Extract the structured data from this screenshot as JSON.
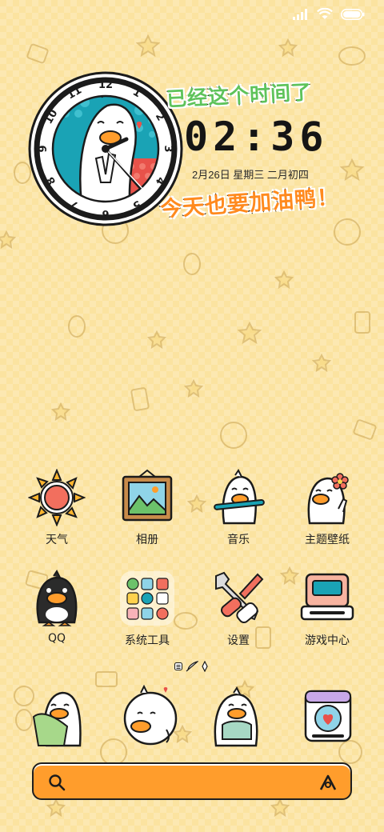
{
  "colors": {
    "background": "#fbe3a0",
    "accent_orange": "#ff9d2c",
    "slogan_green": "#5ec35a",
    "slogan_orange": "#ff8a1e",
    "clock_teal": "#1aa3b5",
    "clock_red": "#e8524a"
  },
  "status_bar": {
    "icons": [
      "signal-icon",
      "wifi-icon",
      "battery-icon"
    ]
  },
  "widget": {
    "slogan_top": "已经这个时间了",
    "time": "02:36",
    "date": "2月26日 星期三 二月初四",
    "slogan_bottom": "今天也要加油鸭！",
    "clock_numbers": [
      "12",
      "1",
      "2",
      "3",
      "4",
      "5",
      "6",
      "7",
      "8",
      "9",
      "10",
      "11"
    ]
  },
  "apps_row1": [
    {
      "label": "天气",
      "icon": "sun-icon"
    },
    {
      "label": "相册",
      "icon": "picture-frame-icon"
    },
    {
      "label": "音乐",
      "icon": "duck-flute-icon"
    },
    {
      "label": "主题壁纸",
      "icon": "duck-flower-icon"
    }
  ],
  "apps_row2": [
    {
      "label": "QQ",
      "icon": "black-duck-icon"
    },
    {
      "label": "系统工具",
      "icon": "folder-icon"
    },
    {
      "label": "设置",
      "icon": "tools-icon"
    },
    {
      "label": "游戏中心",
      "icon": "game-console-icon"
    }
  ],
  "page_indicator": [
    "list-icon",
    "feather-icon",
    "pin-icon"
  ],
  "dock": [
    {
      "icon": "duck-towel-icon"
    },
    {
      "icon": "duck-heart-icon"
    },
    {
      "icon": "duck-sweater-icon"
    },
    {
      "icon": "camera-heart-icon"
    }
  ],
  "search": {
    "left_icon": "search-icon",
    "right_icon": "assistant-logo-icon"
  }
}
